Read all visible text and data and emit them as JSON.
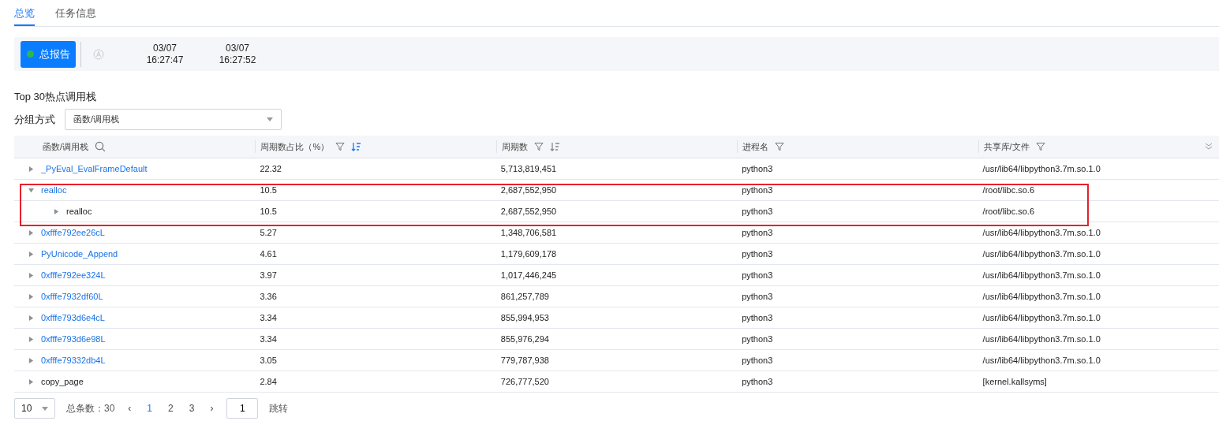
{
  "tabs": [
    {
      "label": "总览",
      "selected": true
    },
    {
      "label": "任务信息",
      "selected": false
    }
  ],
  "toolbar": {
    "report_button": {
      "label": "总报告",
      "online": true
    },
    "timestamps": [
      {
        "date": "03/07",
        "time": "16:27:47"
      },
      {
        "date": "03/07",
        "time": "16:27:52"
      }
    ]
  },
  "section_title": "Top 30热点调用栈",
  "group_by": {
    "label": "分组方式",
    "value": "函数/调用栈"
  },
  "table": {
    "columns": [
      {
        "label": "函数/调用栈",
        "kind": "search"
      },
      {
        "label": "周期数占比（%）",
        "kind": "filter-sort-active"
      },
      {
        "label": "周期数",
        "kind": "filter-sort"
      },
      {
        "label": "进程名",
        "kind": "filter"
      },
      {
        "label": "共享库/文件",
        "kind": "filter"
      }
    ],
    "rows": [
      {
        "link": true,
        "expanded": false,
        "highlighted": false,
        "cells": [
          "_PyEval_EvalFrameDefault",
          "22.32",
          "5,713,819,451",
          "python3",
          "/usr/lib64/libpython3.7m.so.1.0"
        ]
      },
      {
        "link": true,
        "expanded": true,
        "highlighted": true,
        "cells": [
          "realloc",
          "10.5",
          "2,687,552,950",
          "python3",
          "/root/libc.so.6"
        ],
        "children": [
          {
            "link": false,
            "expanded": false,
            "cells": [
              "realloc",
              "10.5",
              "2,687,552,950",
              "python3",
              "/root/libc.so.6"
            ]
          }
        ]
      },
      {
        "link": true,
        "expanded": false,
        "highlighted": false,
        "cells": [
          "0xfffe792ee26cL",
          "5.27",
          "1,348,706,581",
          "python3",
          "/usr/lib64/libpython3.7m.so.1.0"
        ]
      },
      {
        "link": true,
        "expanded": false,
        "highlighted": false,
        "cells": [
          "PyUnicode_Append",
          "4.61",
          "1,179,609,178",
          "python3",
          "/usr/lib64/libpython3.7m.so.1.0"
        ]
      },
      {
        "link": true,
        "expanded": false,
        "highlighted": false,
        "cells": [
          "0xfffe792ee324L",
          "3.97",
          "1,017,446,245",
          "python3",
          "/usr/lib64/libpython3.7m.so.1.0"
        ]
      },
      {
        "link": true,
        "expanded": false,
        "highlighted": false,
        "cells": [
          "0xfffe7932df60L",
          "3.36",
          "861,257,789",
          "python3",
          "/usr/lib64/libpython3.7m.so.1.0"
        ]
      },
      {
        "link": true,
        "expanded": false,
        "highlighted": false,
        "cells": [
          "0xfffe793d6e4cL",
          "3.34",
          "855,994,953",
          "python3",
          "/usr/lib64/libpython3.7m.so.1.0"
        ]
      },
      {
        "link": true,
        "expanded": false,
        "highlighted": false,
        "cells": [
          "0xfffe793d6e98L",
          "3.34",
          "855,976,294",
          "python3",
          "/usr/lib64/libpython3.7m.so.1.0"
        ]
      },
      {
        "link": true,
        "expanded": false,
        "highlighted": false,
        "cells": [
          "0xfffe79332db4L",
          "3.05",
          "779,787,938",
          "python3",
          "/usr/lib64/libpython3.7m.so.1.0"
        ]
      },
      {
        "link": false,
        "expanded": false,
        "highlighted": false,
        "cells": [
          "copy_page",
          "2.84",
          "726,777,520",
          "python3",
          "[kernel.kallsyms]"
        ]
      }
    ]
  },
  "pagination": {
    "page_size": "10",
    "total": "总条数：30",
    "prev": "‹",
    "pages": [
      {
        "label": "1",
        "selected": true
      },
      {
        "label": "2",
        "selected": false
      },
      {
        "label": "3",
        "selected": false
      }
    ],
    "next": "›",
    "jump_value": "1",
    "jump_label": "跳转"
  }
}
